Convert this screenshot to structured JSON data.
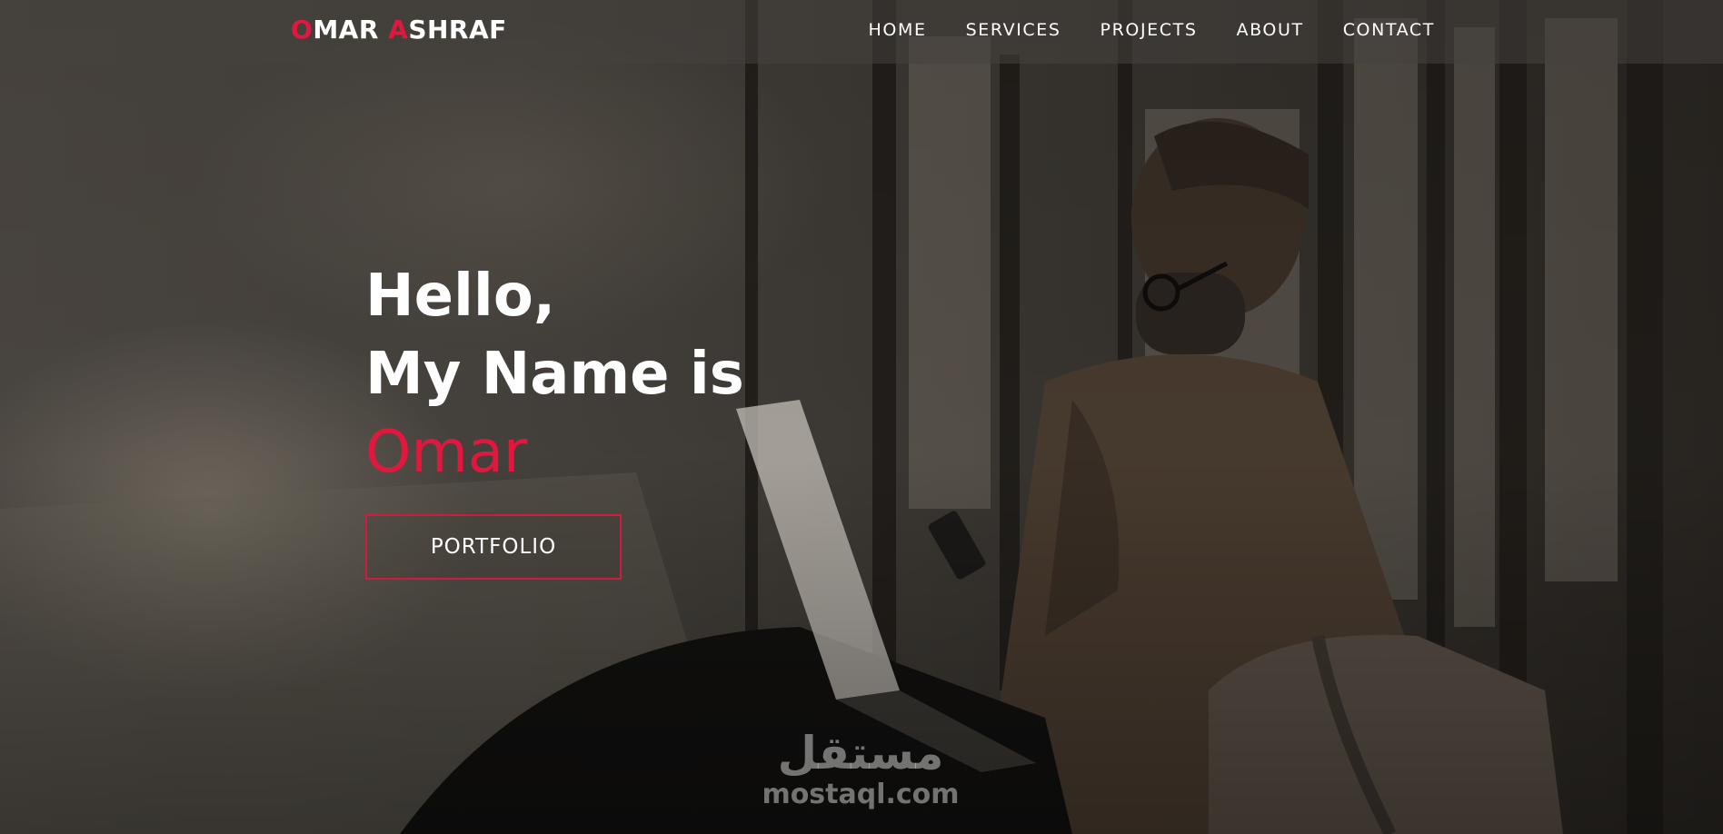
{
  "brand": {
    "first_initial": "O",
    "first_rest": "MAR ",
    "last_initial": "A",
    "last_rest": "SHRAF"
  },
  "nav": {
    "items": [
      {
        "label": "HOME"
      },
      {
        "label": "SERVICES"
      },
      {
        "label": "PROJECTS"
      },
      {
        "label": "ABOUT"
      },
      {
        "label": "CONTACT"
      }
    ]
  },
  "hero": {
    "line1": "Hello,",
    "line2": "My Name is",
    "name": "Omar",
    "button_label": "PORTFOLIO"
  },
  "watermark": {
    "arabic": "مستقل",
    "domain": "mostaql.com"
  },
  "colors": {
    "accent": "#e0183e",
    "text": "#ffffff",
    "nav_bg": "#46423e"
  }
}
